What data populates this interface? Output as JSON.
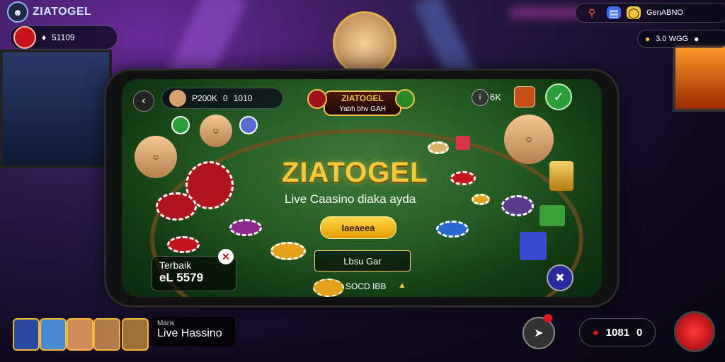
{
  "hud": {
    "brand": "ZIATOGEL",
    "balance_value": "51109",
    "top_right_label": "GenABNO",
    "top_right_sub": "3.0 WGG"
  },
  "phone": {
    "player_value_1": "P200K",
    "player_value_2": "0",
    "player_value_3": "1010",
    "game_tag_line1": "ZIATOGEL",
    "game_tag_line2": "Yabh bhv GAH",
    "top_right_badge": "6K",
    "title": "ZIATOGEL",
    "subtitle": "Live Caasino diaka ayda",
    "cta_label": "Iaeaeea",
    "secondary_label": "Lbsu Gar",
    "terbaik_label": "Terbaik",
    "terbaik_value": "eL 5579",
    "bottom_chip_label": "SOCD IBB"
  },
  "footer": {
    "live_small": "Maris",
    "live_big": "Live Hassino",
    "counter_value": "1081",
    "counter_suffix": "0"
  },
  "colors": {
    "felt": "#245a24",
    "gold": "#f7c83a",
    "red": "#c4141c"
  }
}
